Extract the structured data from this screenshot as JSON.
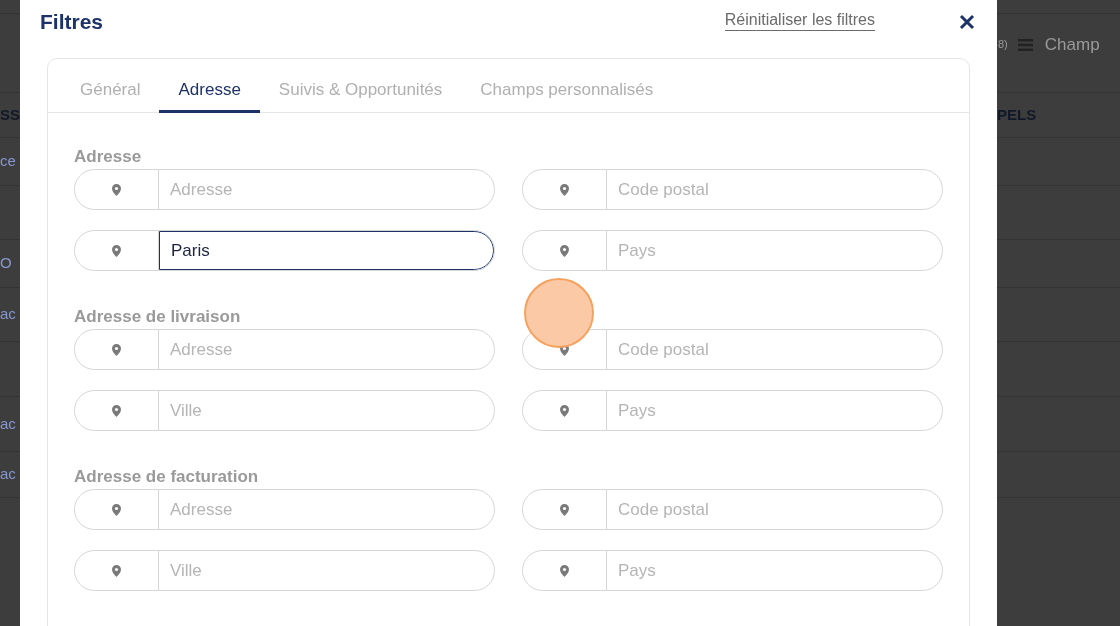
{
  "background": {
    "left_cells": [
      {
        "text": "SS",
        "kind": "header"
      },
      {
        "text": "ce",
        "kind": "link"
      },
      {
        "text": "O",
        "kind": "link"
      },
      {
        "text": "ac",
        "kind": "link"
      },
      {
        "text": "ac",
        "kind": "link"
      },
      {
        "text": "ac",
        "kind": "link"
      }
    ],
    "right_toolbar": {
      "count": "8)",
      "button": "Champ"
    },
    "right_header": "PELS"
  },
  "dialog": {
    "title": "Filtres",
    "reset_link": "Réinitialiser les filtres",
    "tabs": [
      {
        "label": "Général",
        "selected": false
      },
      {
        "label": "Adresse",
        "selected": true
      },
      {
        "label": "Suivis & Opportunités",
        "selected": false
      },
      {
        "label": "Champs personnalisés",
        "selected": false
      }
    ],
    "sections": [
      {
        "heading": "Adresse",
        "fields": [
          {
            "placeholder": "Adresse"
          },
          {
            "placeholder": "Code postal"
          },
          {
            "value": "Paris",
            "focused": true
          },
          {
            "placeholder": "Pays"
          }
        ]
      },
      {
        "heading": "Adresse de livraison",
        "fields": [
          {
            "placeholder": "Adresse"
          },
          {
            "placeholder": "Code postal"
          },
          {
            "placeholder": "Ville"
          },
          {
            "placeholder": "Pays"
          }
        ]
      },
      {
        "heading": "Adresse de facturation",
        "fields": [
          {
            "placeholder": "Adresse"
          },
          {
            "placeholder": "Code postal"
          },
          {
            "placeholder": "Ville"
          },
          {
            "placeholder": "Pays"
          }
        ]
      }
    ]
  }
}
